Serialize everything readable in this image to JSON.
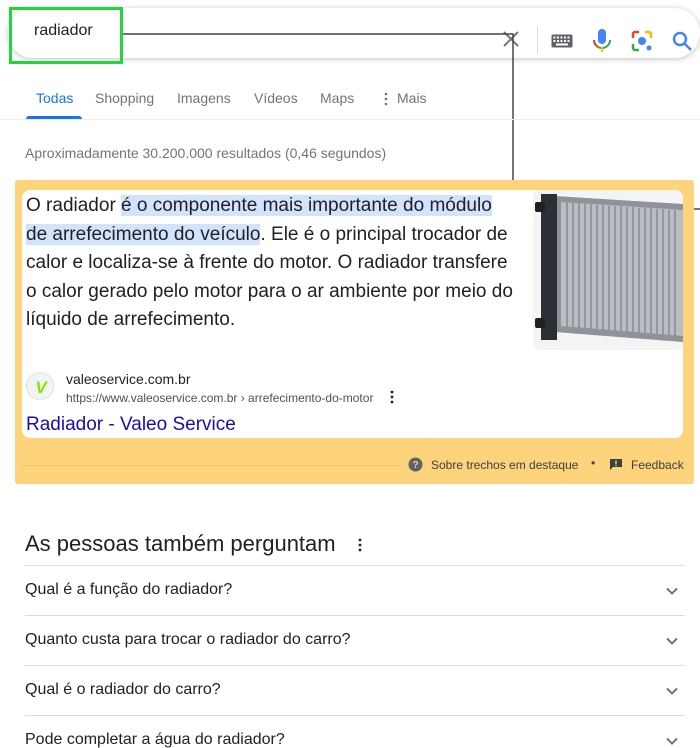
{
  "search": {
    "query": "radiador"
  },
  "tabs": [
    {
      "label": "Todas",
      "active": true
    },
    {
      "label": "Shopping",
      "active": false
    },
    {
      "label": "Imagens",
      "active": false
    },
    {
      "label": "Vídeos",
      "active": false
    },
    {
      "label": "Maps",
      "active": false
    },
    {
      "label": "Mais",
      "active": false
    }
  ],
  "result_stats": "Aproximadamente 30.200.000 resultados (0,46 segundos)",
  "snippet": {
    "text_before": "O radiador ",
    "text_highlight": "é o componente mais importante do módulo de arrefecimento do veículo",
    "text_after": ". Ele é o principal trocador de calor e localiza-se à frente do motor. O radiador transfere o calor gerado pelo motor para o ar ambiente por meio do líquido de arrefecimento.",
    "source_site": "valeoservice.com.br",
    "source_url": "https://www.valeoservice.com.br › arrefecimento-do-motor",
    "source_favicon_letter": "V",
    "result_title": "Radiador - Valeo Service",
    "about_label": "Sobre trechos em destaque",
    "bullet": "•",
    "feedback_label": "Feedback"
  },
  "paa": {
    "title": "As pessoas também perguntam",
    "questions": [
      "Qual é a função do radiador?",
      "Quanto custa para trocar o radiador do carro?",
      "Qual é o radiador do carro?",
      "Pode completar a água do radiador?"
    ]
  },
  "colors": {
    "accent": "#1a73e8",
    "link": "#1a0dab",
    "snippet_highlight_bg": "#fdd37c",
    "text_highlight": "#d3e3fd",
    "annotation_green": "#22d53c"
  },
  "icons": {
    "clear": "close-icon",
    "keyboard": "keyboard-icon",
    "mic": "microphone-icon",
    "lens": "camera-lens-icon",
    "search": "search-icon",
    "more": "more-vertical-icon",
    "help": "help-circle-icon",
    "feedback": "feedback-icon",
    "chevron": "chevron-down-icon"
  }
}
